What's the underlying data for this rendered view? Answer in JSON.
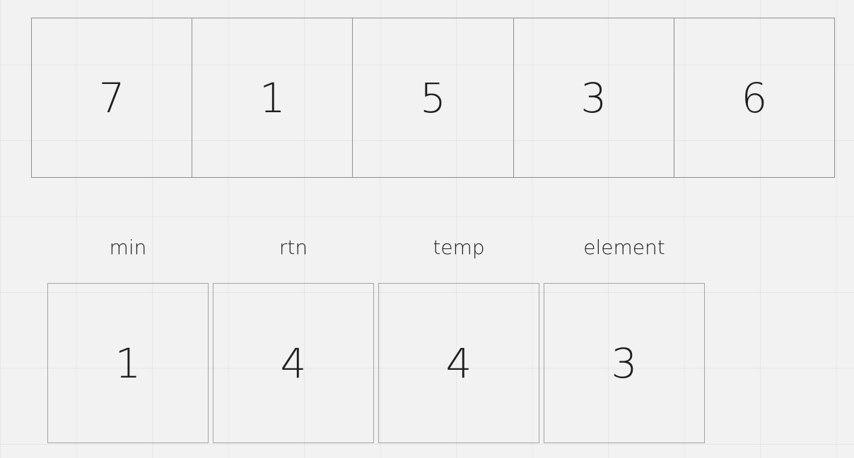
{
  "array": {
    "cells": [
      "7",
      "1",
      "5",
      "3",
      "6"
    ]
  },
  "variables": [
    {
      "label": "min",
      "value": "1"
    },
    {
      "label": "rtn",
      "value": "4"
    },
    {
      "label": "temp",
      "value": "4"
    },
    {
      "label": "element",
      "value": "3"
    }
  ]
}
